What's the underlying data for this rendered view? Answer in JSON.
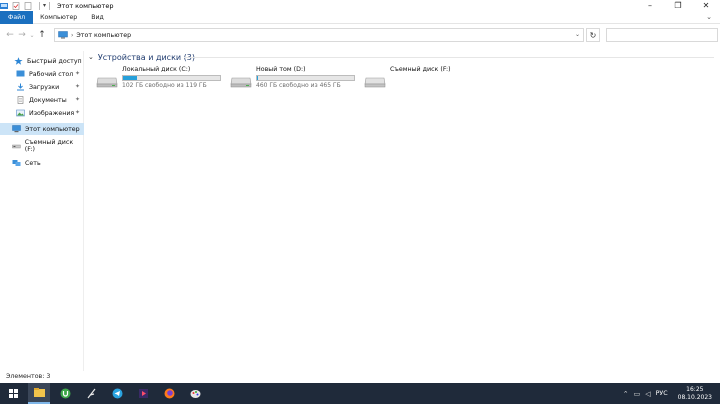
{
  "window": {
    "title": "Этот компьютер"
  },
  "ribbon": {
    "tabs": [
      {
        "label": "Файл"
      },
      {
        "label": "Компьютер"
      },
      {
        "label": "Вид"
      }
    ]
  },
  "address": {
    "crumb": "Этот компьютер",
    "search_placeholder": ""
  },
  "sidebar": {
    "items": [
      {
        "label": "Быстрый доступ",
        "icon": "star-icon"
      },
      {
        "label": "Рабочий стол",
        "icon": "desktop-icon",
        "pinned": true
      },
      {
        "label": "Загрузки",
        "icon": "download-icon",
        "pinned": true
      },
      {
        "label": "Документы",
        "icon": "document-icon",
        "pinned": true
      },
      {
        "label": "Изображения",
        "icon": "image-icon",
        "pinned": true
      },
      {
        "label": "Этот компьютер",
        "icon": "computer-icon",
        "selected": true
      },
      {
        "label": "Съемный диск (F:)",
        "icon": "usb-drive-icon"
      },
      {
        "label": "Сеть",
        "icon": "network-icon"
      }
    ]
  },
  "content": {
    "group_title": "Устройства и диски (3)",
    "drives": [
      {
        "name": "Локальный диск (C:)",
        "info": "102 ГБ свободно из 119 ГБ",
        "used_fraction": 0.143
      },
      {
        "name": "Новый том (D:)",
        "info": "460 ГБ свободно из 465 ГБ",
        "used_fraction": 0.011
      },
      {
        "name": "Съемный диск (F:)",
        "info": "",
        "used_fraction": null
      }
    ]
  },
  "status": {
    "text": "Элементов: 3"
  },
  "taskbar": {
    "language": "РУС",
    "time": "16:25",
    "date": "08.10.2023"
  },
  "colors": {
    "accent": "#1a6fbf",
    "drive_fill": "#26a0da",
    "selection": "#cce4f7",
    "taskbar": "#1f2a3a"
  }
}
